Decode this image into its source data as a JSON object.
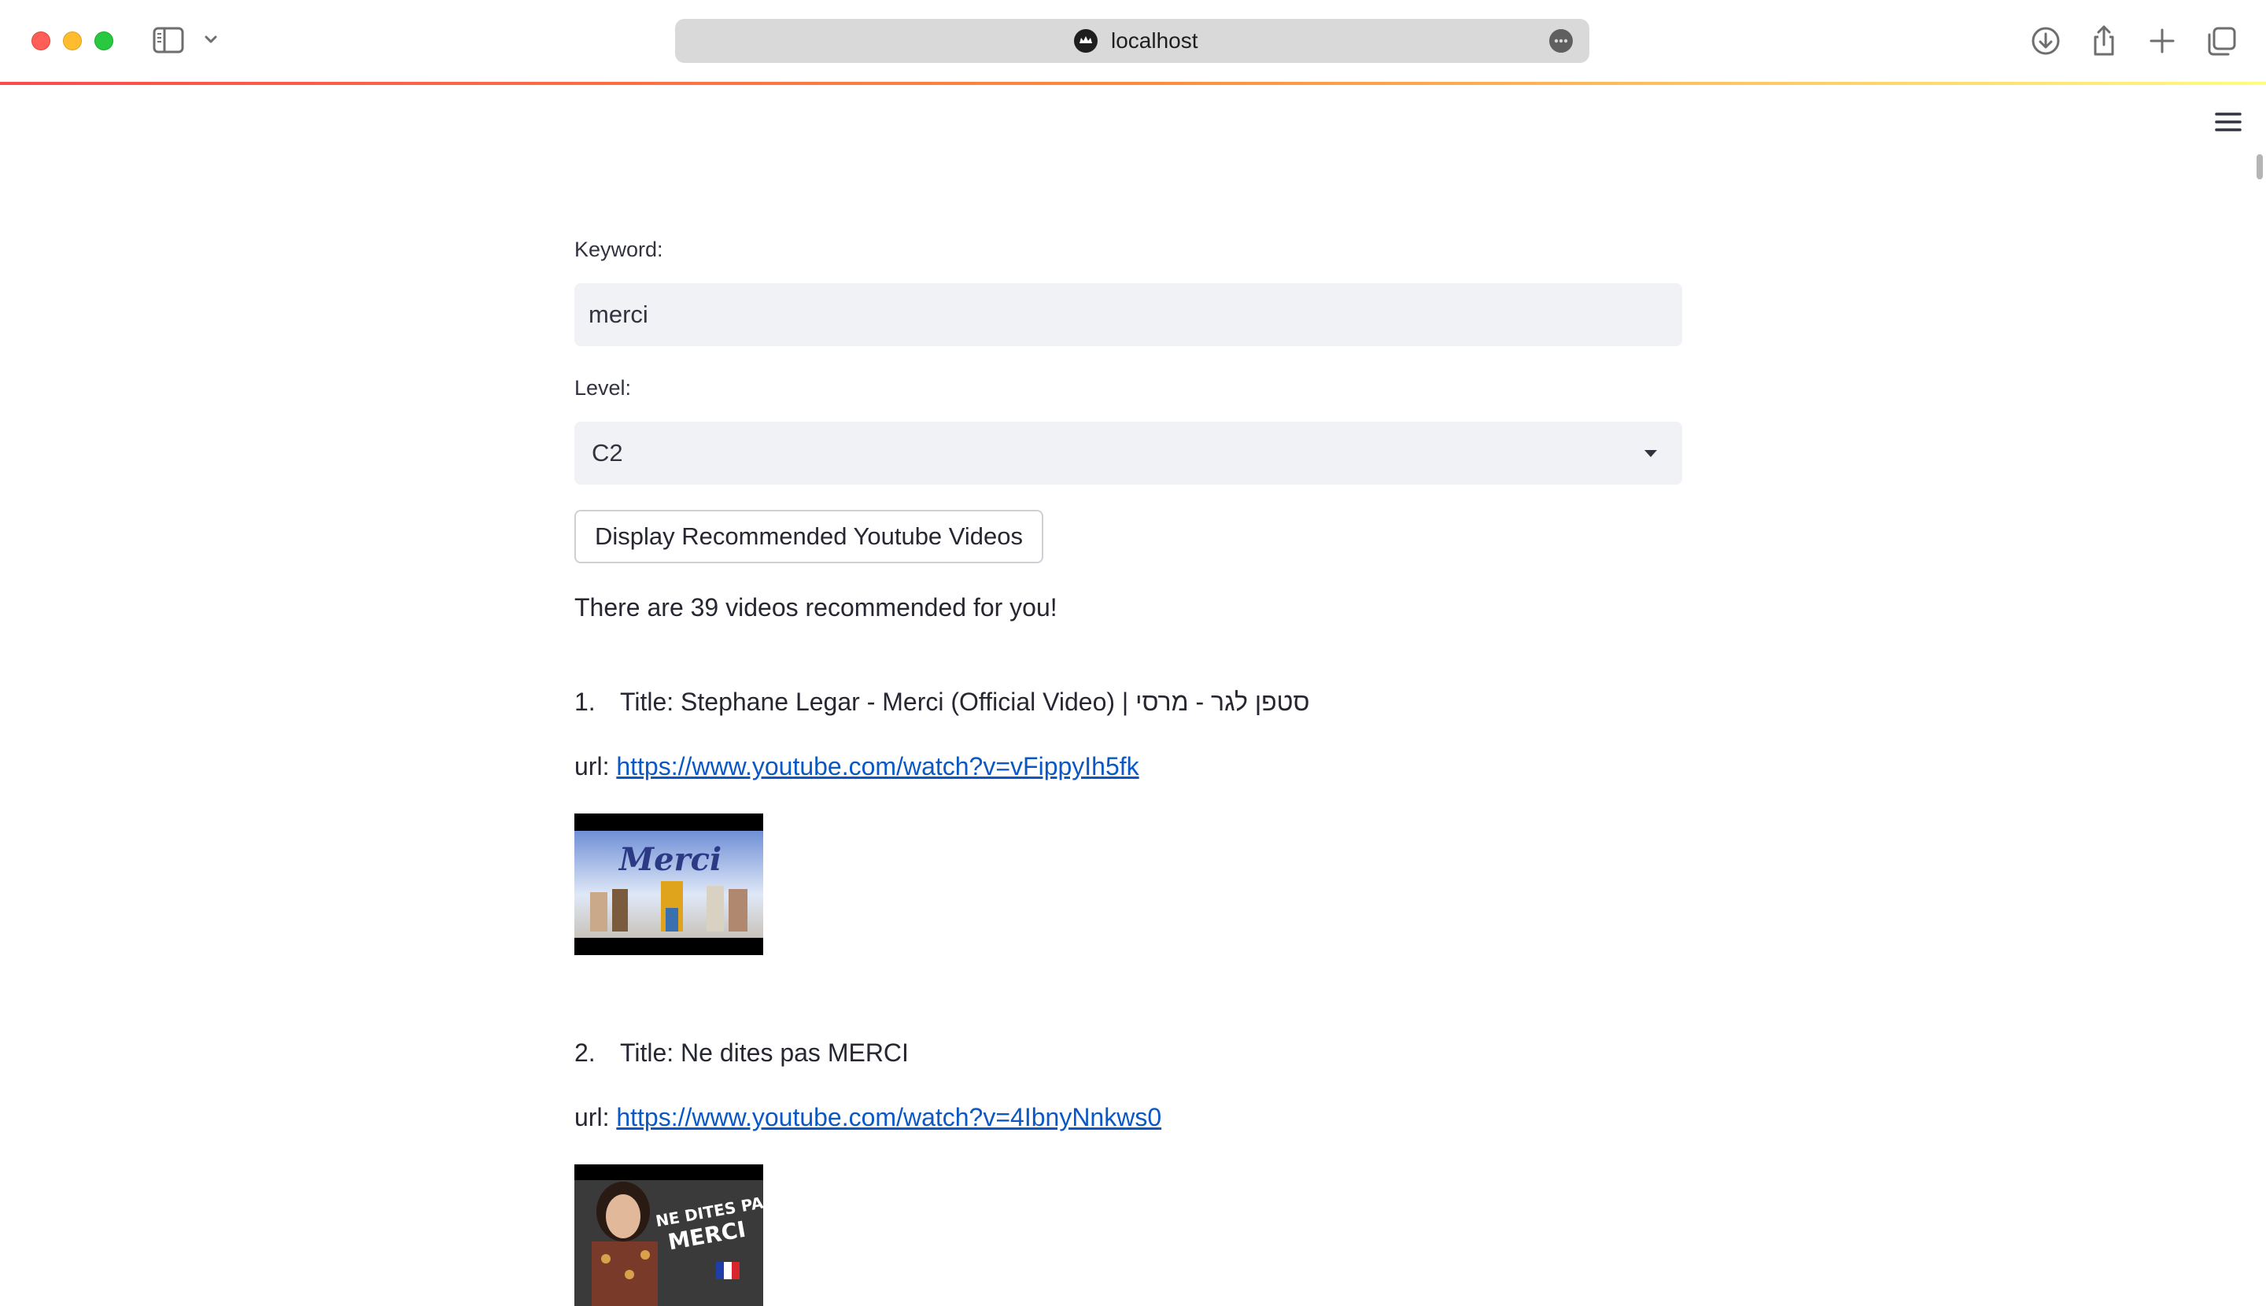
{
  "browser": {
    "url": "localhost"
  },
  "form": {
    "keyword_label": "Keyword:",
    "keyword_value": "merci",
    "level_label": "Level:",
    "level_value": "C2",
    "button_label": "Display Recommended Youtube Videos"
  },
  "summary": "There are 39 videos recommended for you!",
  "results": [
    {
      "number": "1.",
      "title": "Title: Stephane Legar - Merci (Official Video) | סטפן לגר - מרסי",
      "url_label": "url:",
      "url": "https://www.youtube.com/watch?v=vFippyIh5fk",
      "thumb_text": "Merci"
    },
    {
      "number": "2.",
      "title": "Title: Ne dites pas MERCI",
      "url_label": "url:",
      "url": "https://www.youtube.com/watch?v=4IbnyNnkws0",
      "thumb_text_1": "NE DITES PAS",
      "thumb_text_2": "MERCI"
    }
  ],
  "colors": {
    "accent": "#ff4b4b",
    "link": "#0b58c4",
    "input_bg": "#f0f2f6"
  }
}
